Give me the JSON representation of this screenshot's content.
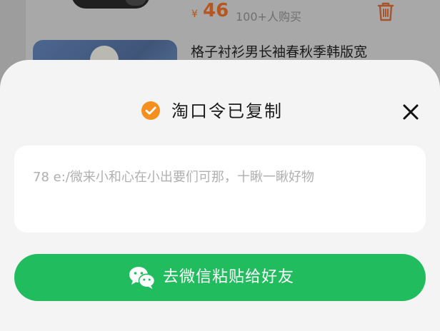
{
  "background_item": {
    "price_symbol": "¥",
    "price": "46",
    "sold_count": "100+人购买",
    "next_item_title": "格子衬衫男长袖春秋季韩版宽"
  },
  "sheet": {
    "title": "淘口令已复制",
    "code_text": "78 e:/微来小和心在小出要们可那，十瞅一瞅好物",
    "action_button_label": "去微信粘贴给好友"
  },
  "colors": {
    "check_orange": "#f5901e",
    "wechat_green": "#21bc5e",
    "price_orange": "#b5571e"
  },
  "icons": {
    "check": "check-circle-icon",
    "close": "close-icon",
    "wechat": "wechat-icon",
    "trash": "trash-icon"
  }
}
